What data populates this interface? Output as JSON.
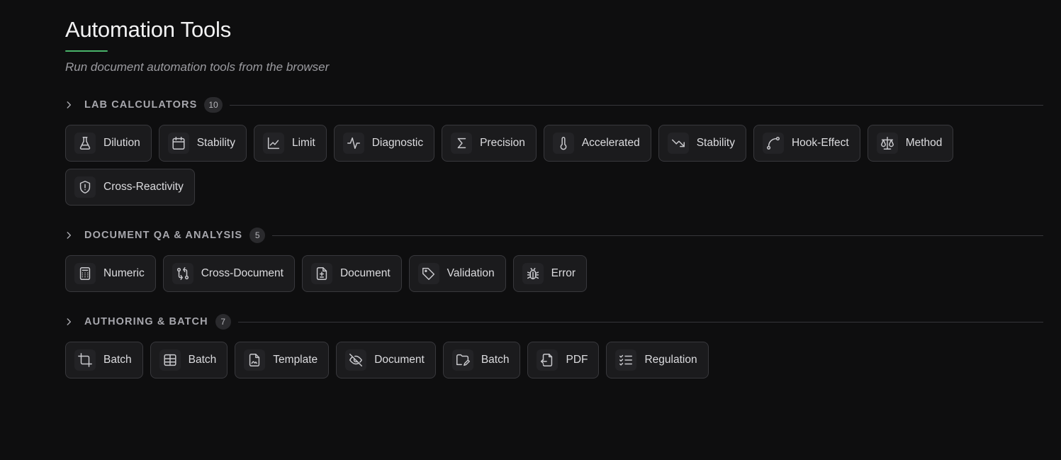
{
  "header": {
    "title": "Automation Tools",
    "subtitle": "Run document automation tools from the browser"
  },
  "colors": {
    "accent": "#49b36a",
    "background": "#0e0e0f",
    "button_bg": "#1b1b1d",
    "button_border": "#38383c"
  },
  "sections": [
    {
      "title": "LAB CALCULATORS",
      "count": "10",
      "tools": [
        {
          "label": "Dilution",
          "icon": "flask-icon"
        },
        {
          "label": "Stability",
          "icon": "calendar-icon"
        },
        {
          "label": "Limit",
          "icon": "line-chart-icon"
        },
        {
          "label": "Diagnostic",
          "icon": "activity-icon"
        },
        {
          "label": "Precision",
          "icon": "sigma-icon"
        },
        {
          "label": "Accelerated",
          "icon": "thermometer-icon"
        },
        {
          "label": "Stability",
          "icon": "trending-down-icon"
        },
        {
          "label": "Hook-Effect",
          "icon": "curve-icon"
        },
        {
          "label": "Method",
          "icon": "scale-icon"
        },
        {
          "label": "Cross-Reactivity",
          "icon": "shield-alert-icon"
        }
      ]
    },
    {
      "title": "DOCUMENT QA & ANALYSIS",
      "count": "5",
      "tools": [
        {
          "label": "Numeric",
          "icon": "calculator-icon"
        },
        {
          "label": "Cross-Document",
          "icon": "git-compare-icon"
        },
        {
          "label": "Document",
          "icon": "file-diff-icon"
        },
        {
          "label": "Validation",
          "icon": "tag-icon"
        },
        {
          "label": "Error",
          "icon": "bug-icon"
        }
      ]
    },
    {
      "title": "AUTHORING & BATCH",
      "count": "7",
      "tools": [
        {
          "label": "Batch",
          "icon": "crop-icon"
        },
        {
          "label": "Batch",
          "icon": "table-icon"
        },
        {
          "label": "Template",
          "icon": "file-signature-icon"
        },
        {
          "label": "Document",
          "icon": "eye-off-icon"
        },
        {
          "label": "Batch",
          "icon": "folder-pen-icon"
        },
        {
          "label": "PDF",
          "icon": "file-export-icon"
        },
        {
          "label": "Regulation",
          "icon": "list-checks-icon"
        }
      ]
    }
  ]
}
